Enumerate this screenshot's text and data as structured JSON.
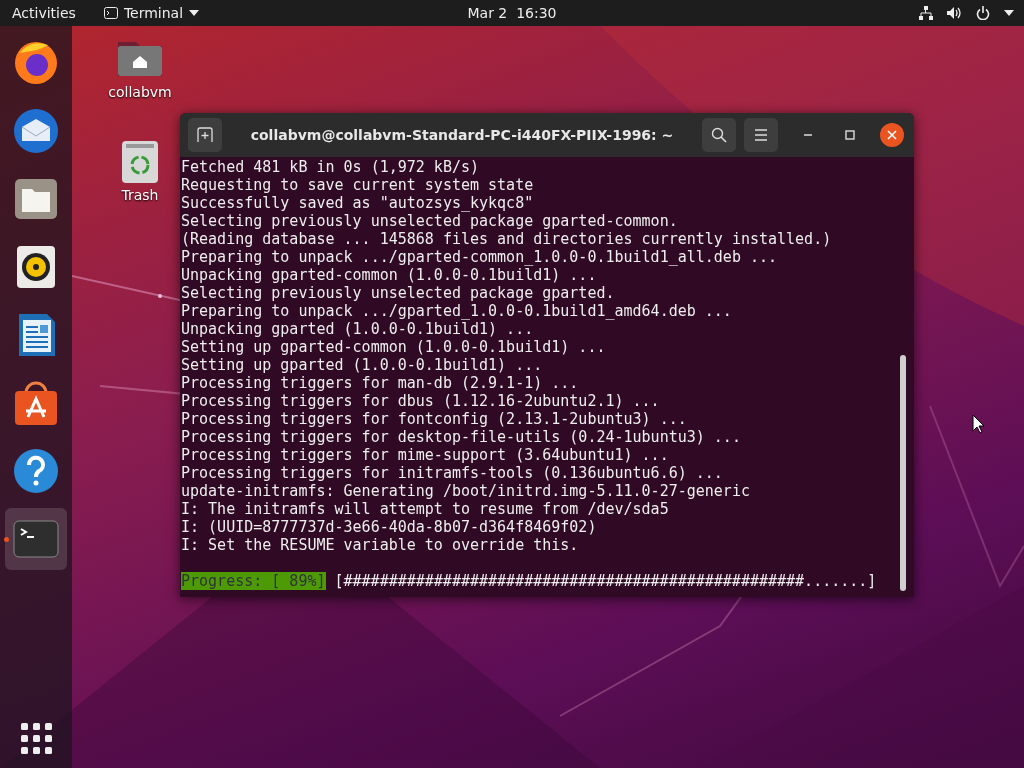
{
  "top_bar": {
    "activities": "Activities",
    "app_menu": "Terminal",
    "clock": "Mar 2  16:30"
  },
  "dock": {
    "items": [
      {
        "kind": "browser",
        "selected": false,
        "running": false
      },
      {
        "kind": "mail",
        "selected": false,
        "running": false
      },
      {
        "kind": "files",
        "selected": false,
        "running": false
      },
      {
        "kind": "music",
        "selected": false,
        "running": false
      },
      {
        "kind": "writer",
        "selected": false,
        "running": false
      },
      {
        "kind": "store",
        "selected": false,
        "running": false
      },
      {
        "kind": "help",
        "selected": false,
        "running": false
      },
      {
        "kind": "terminal",
        "selected": true,
        "running": true
      }
    ]
  },
  "desktop_icons": [
    {
      "kind": "home",
      "label": "collabvm"
    },
    {
      "kind": "trash",
      "label": "Trash"
    }
  ],
  "terminal": {
    "title": "collabvm@collabvm-Standard-PC-i440FX-PIIX-1996: ~",
    "lines": [
      "Fetched 481 kB in 0s (1,972 kB/s)",
      "Requesting to save current system state",
      "Successfully saved as \"autozsys_kykqc8\"",
      "Selecting previously unselected package gparted-common.",
      "(Reading database ... 145868 files and directories currently installed.)",
      "Preparing to unpack .../gparted-common_1.0.0-0.1build1_all.deb ...",
      "Unpacking gparted-common (1.0.0-0.1build1) ...",
      "Selecting previously unselected package gparted.",
      "Preparing to unpack .../gparted_1.0.0-0.1build1_amd64.deb ...",
      "Unpacking gparted (1.0.0-0.1build1) ...",
      "Setting up gparted-common (1.0.0-0.1build1) ...",
      "Setting up gparted (1.0.0-0.1build1) ...",
      "Processing triggers for man-db (2.9.1-1) ...",
      "Processing triggers for dbus (1.12.16-2ubuntu2.1) ...",
      "Processing triggers for fontconfig (2.13.1-2ubuntu3) ...",
      "Processing triggers for desktop-file-utils (0.24-1ubuntu3) ...",
      "Processing triggers for mime-support (3.64ubuntu1) ...",
      "Processing triggers for initramfs-tools (0.136ubuntu6.6) ...",
      "update-initramfs: Generating /boot/initrd.img-5.11.0-27-generic",
      "I: The initramfs will attempt to resume from /dev/sda5",
      "I: (UUID=8777737d-3e66-40da-8b07-d364f8469f02)",
      "I: Set the RESUME variable to override this."
    ],
    "progress": {
      "label": "Progress: [ 89%]",
      "bar": "[###################################################.......]"
    }
  }
}
